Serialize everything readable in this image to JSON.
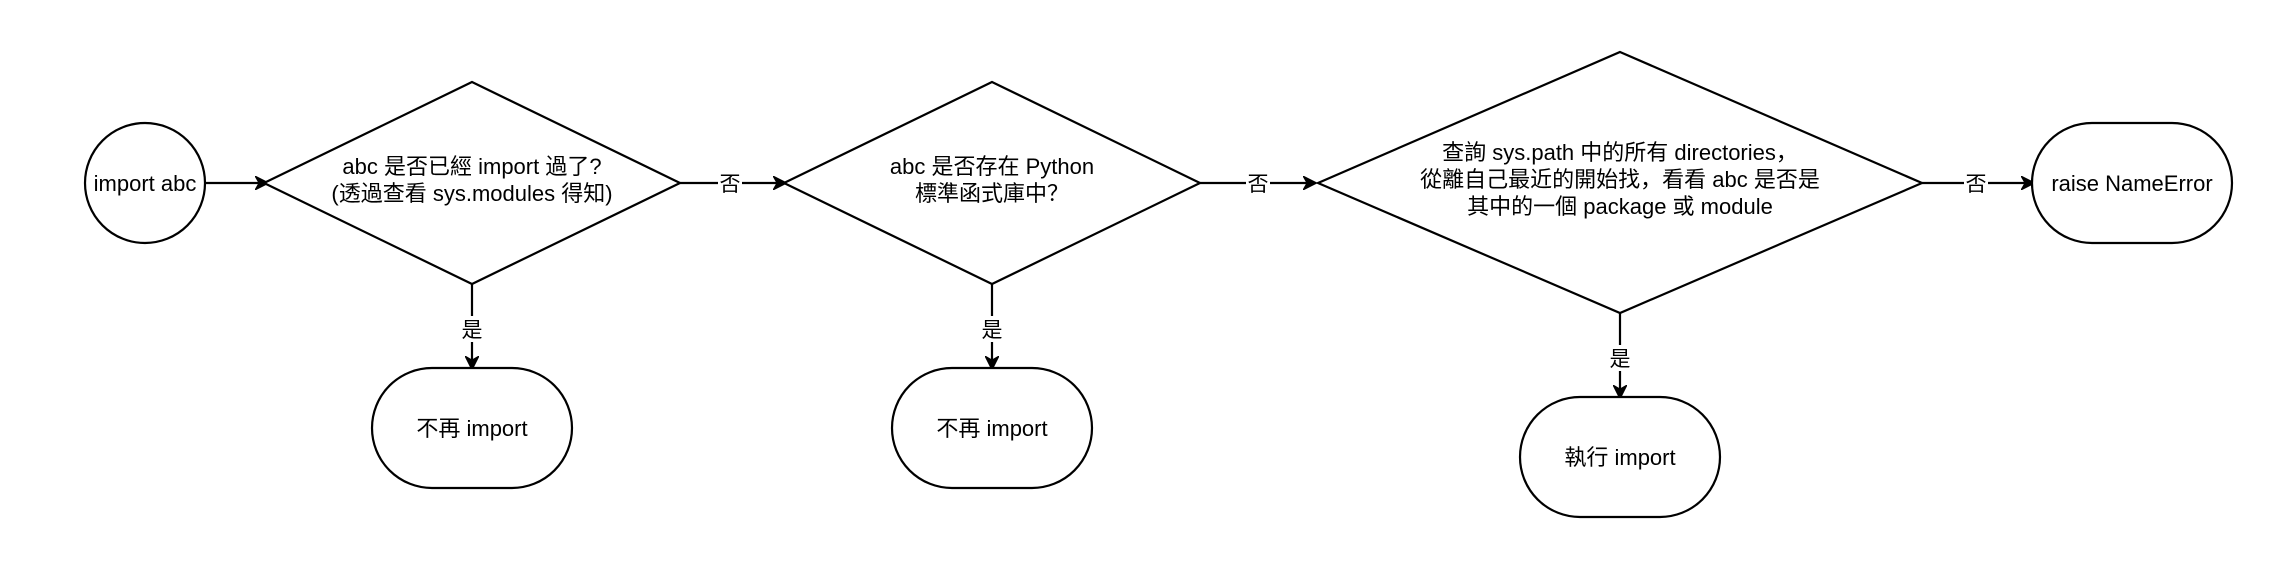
{
  "nodes": {
    "start": {
      "lines": [
        "import abc"
      ]
    },
    "check_imported": {
      "lines": [
        "abc 是否已經 import 過了?",
        "(透過查看 sys.modules 得知)"
      ]
    },
    "not_import_1": {
      "lines": [
        "不再 import"
      ]
    },
    "check_stdlib": {
      "lines": [
        "abc 是否存在 Python",
        "標準函式庫中？"
      ]
    },
    "not_import_2": {
      "lines": [
        "不再 import"
      ]
    },
    "check_syspath": {
      "lines": [
        "查詢 sys.path 中的所有 directories，",
        "從離自己最近的開始找，看看 abc 是否是",
        "其中的一個 package 或 module"
      ]
    },
    "do_import": {
      "lines": [
        "執行 import"
      ]
    },
    "raise_error": {
      "lines": [
        "raise NameError"
      ]
    }
  },
  "edges": {
    "start_to_check_imported": {
      "label": ""
    },
    "check_imported_no": {
      "label": "否"
    },
    "check_imported_yes": {
      "label": "是"
    },
    "check_stdlib_no": {
      "label": "否"
    },
    "check_stdlib_yes": {
      "label": "是"
    },
    "check_syspath_no": {
      "label": "否"
    },
    "check_syspath_yes": {
      "label": "是"
    }
  }
}
